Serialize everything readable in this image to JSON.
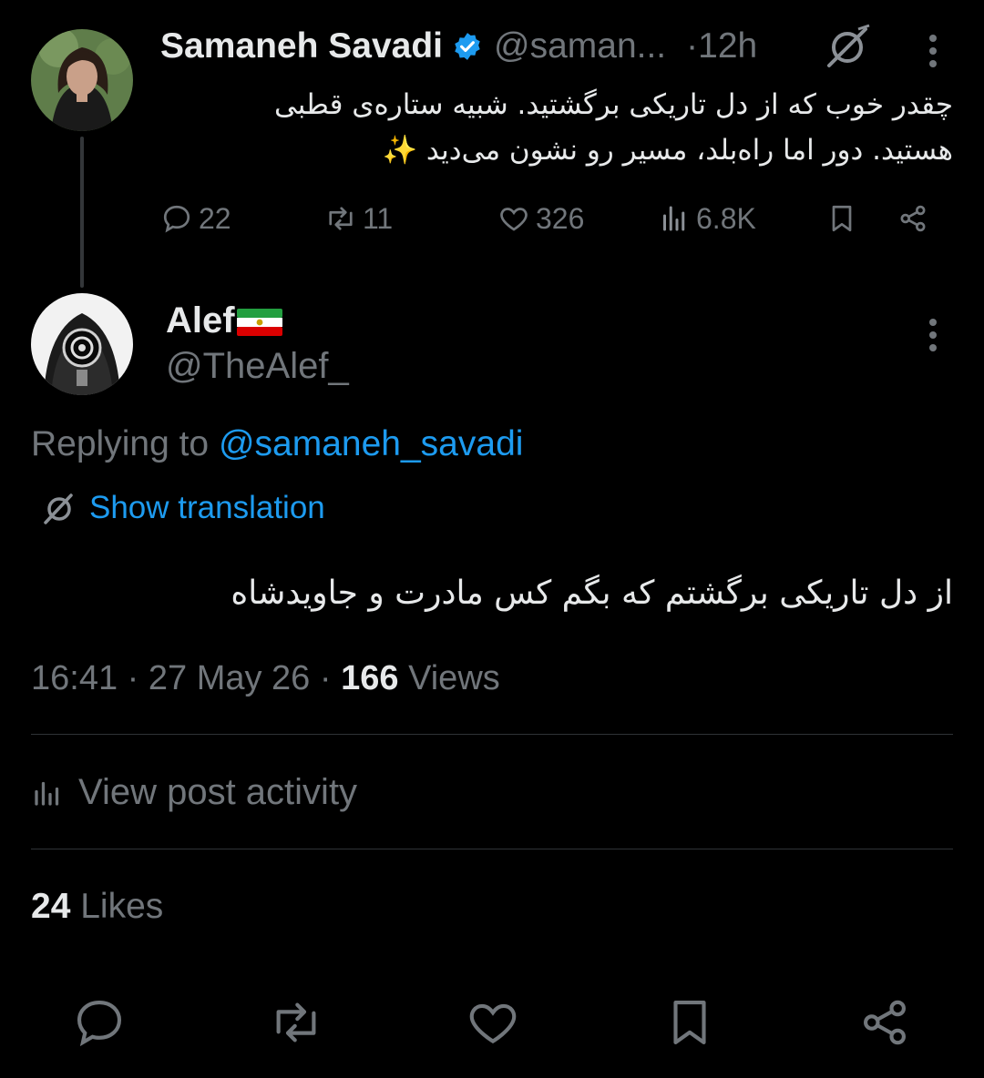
{
  "parent_post": {
    "author_name": "Samaneh Savadi",
    "handle": "@saman...",
    "separator": "·",
    "time": "12h",
    "text_line1": "چقدر خوب که از دل تاریکی برگشتید. شبیه ستاره‌ی قطبی",
    "text_line2": "هستید. دور اما راه‌بلد، مسیر رو نشون می‌دید ✨",
    "stats": {
      "replies": "22",
      "reposts": "11",
      "likes": "326",
      "views": "6.8K"
    },
    "icons": [
      "verified-badge-icon",
      "grok-icon",
      "more-options-icon",
      "reply-icon",
      "repost-icon",
      "like-icon",
      "views-icon",
      "bookmark-icon",
      "share-icon"
    ]
  },
  "reply_post": {
    "author_name": "Alef",
    "handle": "@TheAlef_",
    "replying_prefix": "Replying to",
    "replying_to": "@samaneh_savadi",
    "show_translation": "Show translation",
    "text": "از دل تاریکی برگشتم که بگم کس مادرت و جاویدشاه",
    "time": "16:41",
    "sep1": "·",
    "date": "27 May 26",
    "sep2": "·",
    "views_count": "166",
    "views_label": "Views",
    "view_activity": "View post activity",
    "likes_count": "24",
    "likes_label": "Likes"
  },
  "colors": {
    "background": "#000000",
    "text_primary": "#e7e9ea",
    "text_secondary": "#71767b",
    "accent": "#1d9bf0",
    "divider": "#2f3336"
  }
}
